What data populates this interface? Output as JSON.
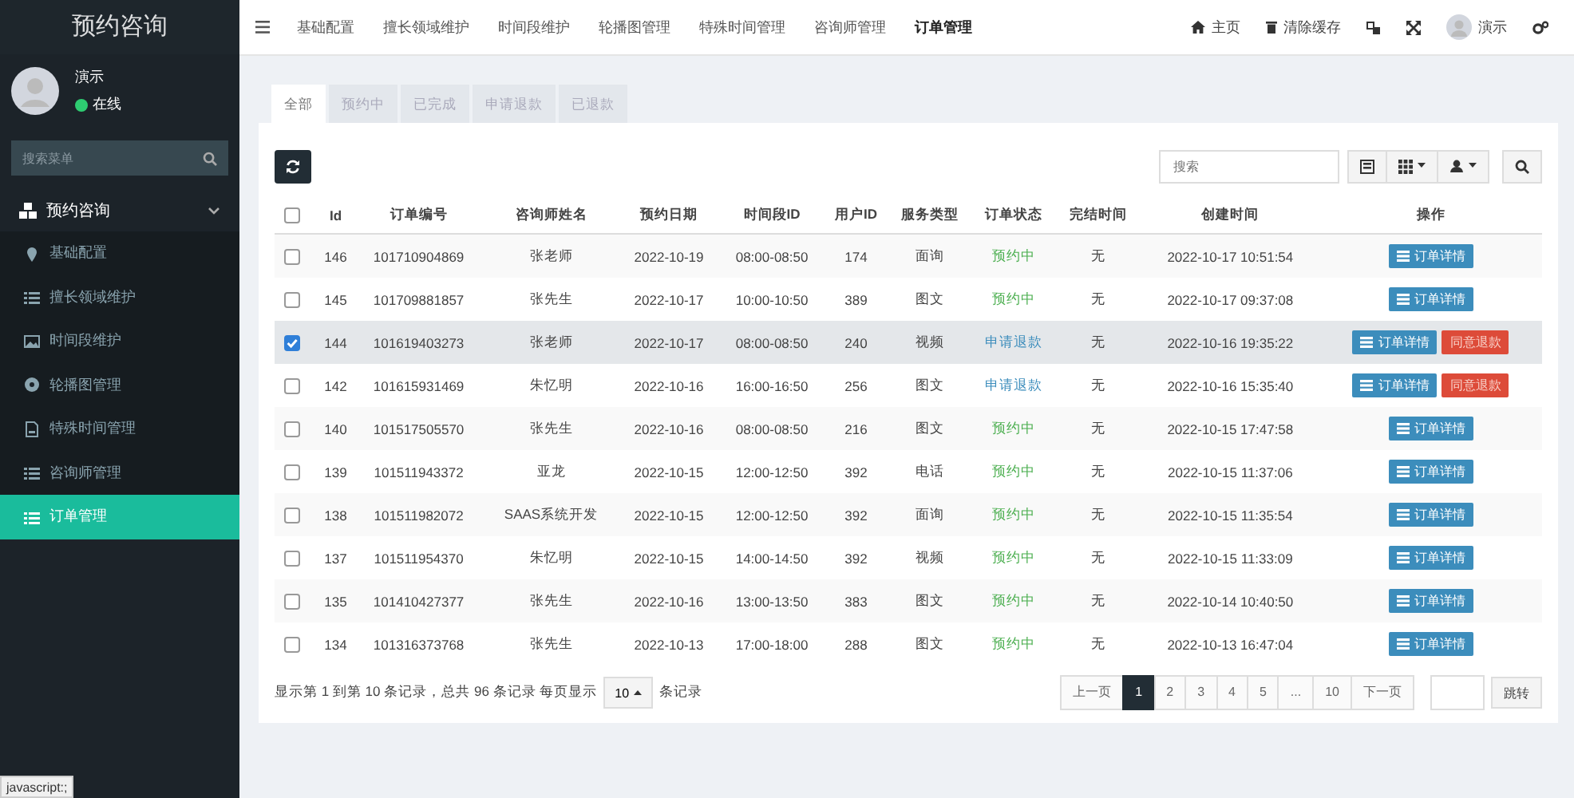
{
  "sidebar": {
    "title": "预约咨询",
    "user": {
      "name": "演示",
      "status": "在线"
    },
    "search": {
      "placeholder": "搜索菜单"
    },
    "group": {
      "label": "预约咨询",
      "expanded": true,
      "children": [
        {
          "label": "基础配置",
          "selected": false
        },
        {
          "label": "擅长领域维护",
          "selected": false
        },
        {
          "label": "时间段维护",
          "selected": false
        },
        {
          "label": "轮播图管理",
          "selected": false
        },
        {
          "label": "特殊时间管理",
          "selected": false
        },
        {
          "label": "咨询师管理",
          "selected": false
        },
        {
          "label": "订单管理",
          "selected": true
        }
      ]
    }
  },
  "topnav": {
    "items": [
      {
        "label": "基础配置",
        "selected": false
      },
      {
        "label": "擅长领域维护",
        "selected": false
      },
      {
        "label": "时间段维护",
        "selected": false
      },
      {
        "label": "轮播图管理",
        "selected": false
      },
      {
        "label": "特殊时间管理",
        "selected": false
      },
      {
        "label": "咨询师管理",
        "selected": false
      },
      {
        "label": "订单管理",
        "selected": true
      }
    ],
    "home": "主页",
    "clear_cache": "清除缓存",
    "user": "演示"
  },
  "tabs": [
    {
      "label": "全部",
      "selected": true
    },
    {
      "label": "预约中",
      "selected": false
    },
    {
      "label": "已完成",
      "selected": false
    },
    {
      "label": "申请退款",
      "selected": false
    },
    {
      "label": "已退款",
      "selected": false
    }
  ],
  "toolbar": {
    "search_placeholder": "搜索"
  },
  "table": {
    "select_all": {
      "checked": false
    },
    "columns": [
      "Id",
      "订单编号",
      "咨询师姓名",
      "预约日期",
      "时间段ID",
      "用户ID",
      "服务类型",
      "订单状态",
      "完结时间",
      "创建时间",
      "操作"
    ],
    "rows": [
      {
        "selected": false,
        "cells": [
          "146",
          "101710904869",
          "张老师",
          "2022-10-19",
          "08:00-08:50",
          "174",
          "面询"
        ],
        "status": {
          "text": "预约中",
          "color": "#4caf50"
        },
        "end": "无",
        "created": "2022-10-17 10:51:54",
        "actions": [
          {
            "kind": "detail",
            "label": "订单详情"
          }
        ]
      },
      {
        "selected": false,
        "cells": [
          "145",
          "101709881857",
          "张先生",
          "2022-10-17",
          "10:00-10:50",
          "389",
          "图文"
        ],
        "status": {
          "text": "预约中",
          "color": "#4caf50"
        },
        "end": "无",
        "created": "2022-10-17 09:37:08",
        "actions": [
          {
            "kind": "detail",
            "label": "订单详情"
          }
        ]
      },
      {
        "selected": true,
        "cells": [
          "144",
          "101619403273",
          "张老师",
          "2022-10-17",
          "08:00-08:50",
          "240",
          "视频"
        ],
        "status": {
          "text": "申请退款",
          "color": "#3c8dbc"
        },
        "end": "无",
        "created": "2022-10-16 19:35:22",
        "actions": [
          {
            "kind": "detail",
            "label": "订单详情"
          },
          {
            "kind": "refund",
            "label": "同意退款"
          }
        ]
      },
      {
        "selected": false,
        "cells": [
          "142",
          "101615931469",
          "朱忆明",
          "2022-10-16",
          "16:00-16:50",
          "256",
          "图文"
        ],
        "status": {
          "text": "申请退款",
          "color": "#3c8dbc"
        },
        "end": "无",
        "created": "2022-10-16 15:35:40",
        "actions": [
          {
            "kind": "detail",
            "label": "订单详情"
          },
          {
            "kind": "refund",
            "label": "同意退款"
          }
        ]
      },
      {
        "selected": false,
        "cells": [
          "140",
          "101517505570",
          "张先生",
          "2022-10-16",
          "08:00-08:50",
          "216",
          "图文"
        ],
        "status": {
          "text": "预约中",
          "color": "#4caf50"
        },
        "end": "无",
        "created": "2022-10-15 17:47:58",
        "actions": [
          {
            "kind": "detail",
            "label": "订单详情"
          }
        ]
      },
      {
        "selected": false,
        "cells": [
          "139",
          "101511943372",
          "亚龙",
          "2022-10-15",
          "12:00-12:50",
          "392",
          "电话"
        ],
        "status": {
          "text": "预约中",
          "color": "#4caf50"
        },
        "end": "无",
        "created": "2022-10-15 11:37:06",
        "actions": [
          {
            "kind": "detail",
            "label": "订单详情"
          }
        ]
      },
      {
        "selected": false,
        "cells": [
          "138",
          "101511982072",
          "SAAS系统开发",
          "2022-10-15",
          "12:00-12:50",
          "392",
          "面询"
        ],
        "status": {
          "text": "预约中",
          "color": "#4caf50"
        },
        "end": "无",
        "created": "2022-10-15 11:35:54",
        "actions": [
          {
            "kind": "detail",
            "label": "订单详情"
          }
        ]
      },
      {
        "selected": false,
        "cells": [
          "137",
          "101511954370",
          "朱忆明",
          "2022-10-15",
          "14:00-14:50",
          "392",
          "视频"
        ],
        "status": {
          "text": "预约中",
          "color": "#4caf50"
        },
        "end": "无",
        "created": "2022-10-15 11:33:09",
        "actions": [
          {
            "kind": "detail",
            "label": "订单详情"
          }
        ]
      },
      {
        "selected": false,
        "cells": [
          "135",
          "101410427377",
          "张先生",
          "2022-10-16",
          "13:00-13:50",
          "383",
          "图文"
        ],
        "status": {
          "text": "预约中",
          "color": "#4caf50"
        },
        "end": "无",
        "created": "2022-10-14 10:40:50",
        "actions": [
          {
            "kind": "detail",
            "label": "订单详情"
          }
        ]
      },
      {
        "selected": false,
        "cells": [
          "134",
          "101316373768",
          "张先生",
          "2022-10-13",
          "17:00-18:00",
          "288",
          "图文"
        ],
        "status": {
          "text": "预约中",
          "color": "#4caf50"
        },
        "end": "无",
        "created": "2022-10-13 16:47:04",
        "actions": [
          {
            "kind": "detail",
            "label": "订单详情"
          }
        ]
      }
    ]
  },
  "footer": {
    "summary": "显示第 1 到第 10 条记录，总共 96 条记录 每页显示",
    "page_size": "10",
    "suffix": "条记录",
    "pages": [
      {
        "label": "上一页",
        "selected": false
      },
      {
        "label": "1",
        "selected": true
      },
      {
        "label": "2",
        "selected": false
      },
      {
        "label": "3",
        "selected": false
      },
      {
        "label": "4",
        "selected": false
      },
      {
        "label": "5",
        "selected": false
      },
      {
        "label": "...",
        "selected": false
      },
      {
        "label": "10",
        "selected": false
      },
      {
        "label": "下一页",
        "selected": false
      }
    ],
    "jump": "跳转"
  },
  "status_bar": "javascript:;"
}
